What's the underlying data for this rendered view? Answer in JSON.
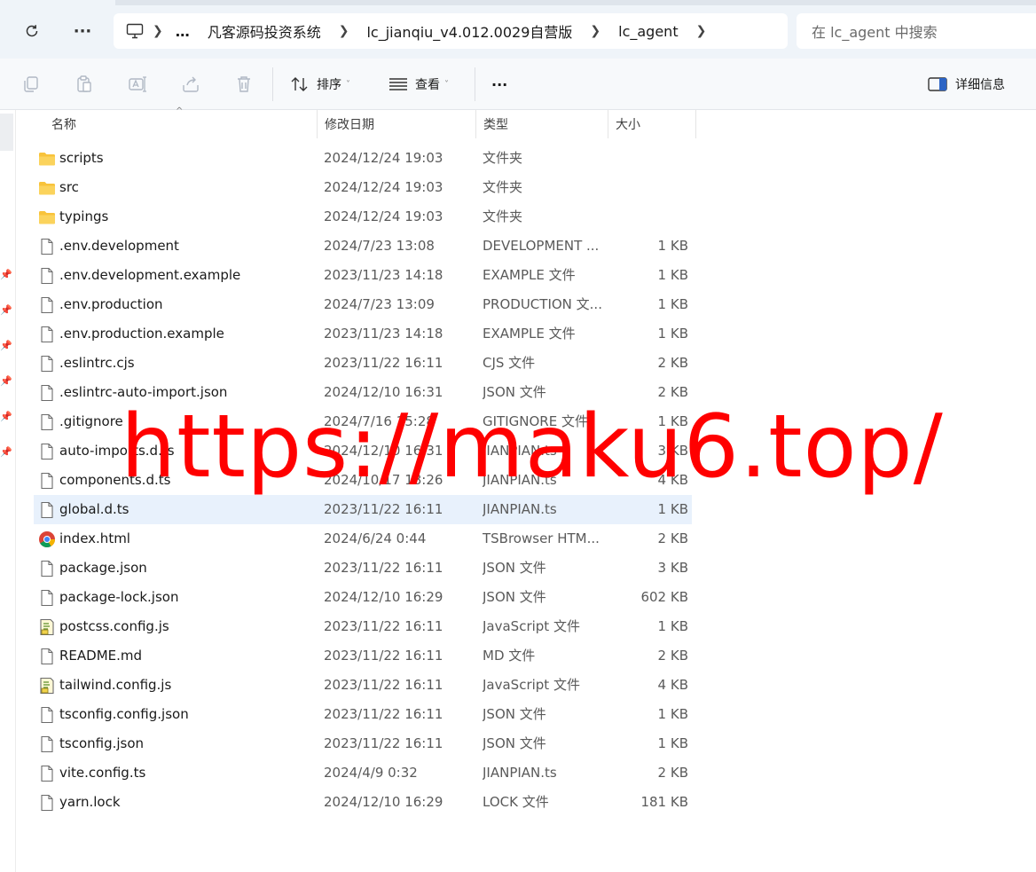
{
  "nav": {
    "refresh_icon": "refresh-icon",
    "more_icon": "more-icon"
  },
  "address_bar": {
    "computer_icon": "computer-icon",
    "overflow": "…",
    "crumbs": [
      "凡客源码投资系统",
      "lc_jianqiu_v4.012.0029自营版",
      "lc_agent"
    ]
  },
  "search": {
    "placeholder": "在 lc_agent 中搜索"
  },
  "toolbar": {
    "sort_label": "排序",
    "view_label": "查看",
    "more_label": "···",
    "details_label": "详细信息"
  },
  "columns": {
    "name": "名称",
    "date": "修改日期",
    "type": "类型",
    "size": "大小"
  },
  "files": [
    {
      "name": "scripts",
      "date": "2024/12/24 19:03",
      "type": "文件夹",
      "size": "",
      "icon": "folder-icon"
    },
    {
      "name": "src",
      "date": "2024/12/24 19:03",
      "type": "文件夹",
      "size": "",
      "icon": "folder-icon"
    },
    {
      "name": "typings",
      "date": "2024/12/24 19:03",
      "type": "文件夹",
      "size": "",
      "icon": "folder-icon"
    },
    {
      "name": ".env.development",
      "date": "2024/7/23 13:08",
      "type": "DEVELOPMENT ...",
      "size": "1 KB",
      "icon": "file-icon"
    },
    {
      "name": ".env.development.example",
      "date": "2023/11/23 14:18",
      "type": "EXAMPLE 文件",
      "size": "1 KB",
      "icon": "file-icon"
    },
    {
      "name": ".env.production",
      "date": "2024/7/23 13:09",
      "type": "PRODUCTION 文...",
      "size": "1 KB",
      "icon": "file-icon"
    },
    {
      "name": ".env.production.example",
      "date": "2023/11/23 14:18",
      "type": "EXAMPLE 文件",
      "size": "1 KB",
      "icon": "file-icon"
    },
    {
      "name": ".eslintrc.cjs",
      "date": "2023/11/22 16:11",
      "type": "CJS 文件",
      "size": "2 KB",
      "icon": "file-icon"
    },
    {
      "name": ".eslintrc-auto-import.json",
      "date": "2024/12/10 16:31",
      "type": "JSON 文件",
      "size": "2 KB",
      "icon": "file-icon"
    },
    {
      "name": ".gitignore",
      "date": "2024/7/16 15:28",
      "type": "GITIGNORE 文件",
      "size": "1 KB",
      "icon": "file-icon"
    },
    {
      "name": "auto-imports.d.ts",
      "date": "2024/12/10 16:31",
      "type": "JIANPIAN.ts",
      "size": "3 KB",
      "icon": "file-icon"
    },
    {
      "name": "components.d.ts",
      "date": "2024/10/17 18:26",
      "type": "JIANPIAN.ts",
      "size": "4 KB",
      "icon": "file-icon"
    },
    {
      "name": "global.d.ts",
      "date": "2023/11/22 16:11",
      "type": "JIANPIAN.ts",
      "size": "1 KB",
      "icon": "file-icon",
      "selected": true
    },
    {
      "name": "index.html",
      "date": "2024/6/24 0:44",
      "type": "TSBrowser HTM...",
      "size": "2 KB",
      "icon": "browser-icon"
    },
    {
      "name": "package.json",
      "date": "2023/11/22 16:11",
      "type": "JSON 文件",
      "size": "3 KB",
      "icon": "file-icon"
    },
    {
      "name": "package-lock.json",
      "date": "2024/12/10 16:29",
      "type": "JSON 文件",
      "size": "602 KB",
      "icon": "file-icon"
    },
    {
      "name": "postcss.config.js",
      "date": "2023/11/22 16:11",
      "type": "JavaScript 文件",
      "size": "1 KB",
      "icon": "script-icon"
    },
    {
      "name": "README.md",
      "date": "2023/11/22 16:11",
      "type": "MD 文件",
      "size": "2 KB",
      "icon": "file-icon"
    },
    {
      "name": "tailwind.config.js",
      "date": "2023/11/22 16:11",
      "type": "JavaScript 文件",
      "size": "4 KB",
      "icon": "script-icon"
    },
    {
      "name": "tsconfig.config.json",
      "date": "2023/11/22 16:11",
      "type": "JSON 文件",
      "size": "1 KB",
      "icon": "file-icon"
    },
    {
      "name": "tsconfig.json",
      "date": "2023/11/22 16:11",
      "type": "JSON 文件",
      "size": "1 KB",
      "icon": "file-icon"
    },
    {
      "name": "vite.config.ts",
      "date": "2024/4/9 0:32",
      "type": "JIANPIAN.ts",
      "size": "2 KB",
      "icon": "file-icon"
    },
    {
      "name": "yarn.lock",
      "date": "2024/12/10 16:29",
      "type": "LOCK 文件",
      "size": "181 KB",
      "icon": "file-icon"
    }
  ],
  "watermark": "https://maku6.top/",
  "colors": {
    "folder": "#f8c33b",
    "selected_row": "#e8f1fc",
    "watermark": "#ff0000"
  }
}
